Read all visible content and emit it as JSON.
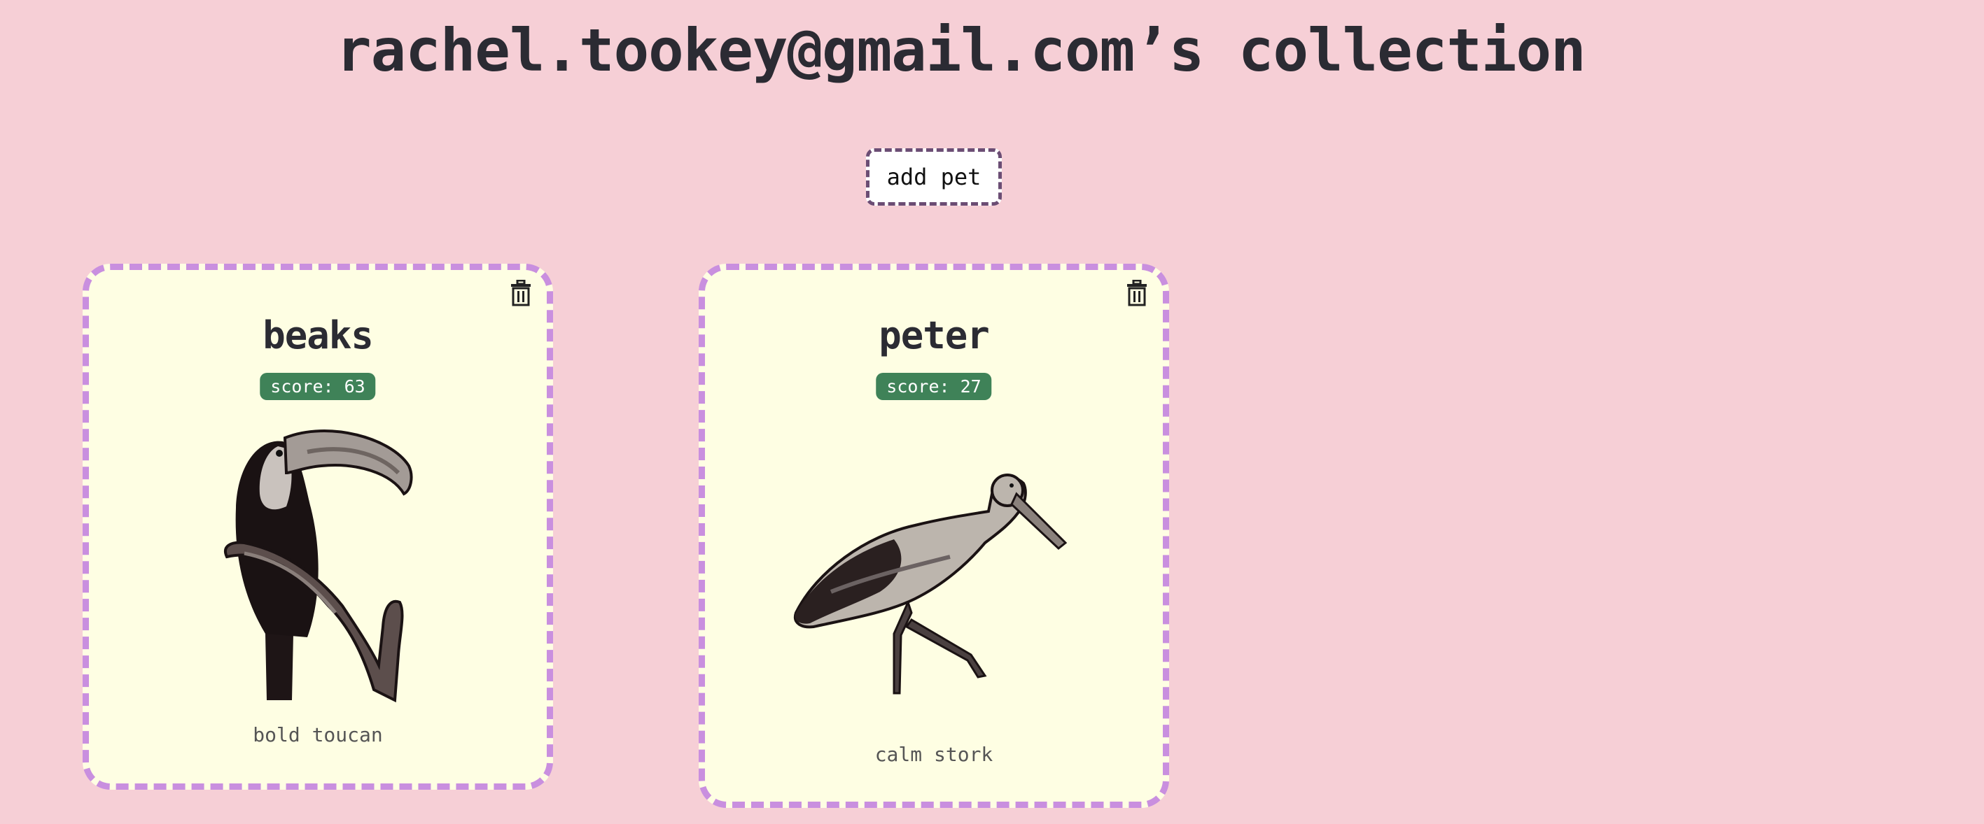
{
  "header": {
    "title": "rachel.tookey@gmail.com’s collection"
  },
  "actions": {
    "add_pet_label": "add pet"
  },
  "colors": {
    "background": "#f6cfd6",
    "card_background": "#fefee3",
    "card_border": "#c98fdf",
    "score_badge": "#3f8258",
    "button_border": "#6b4d74"
  },
  "pets": [
    {
      "name": "beaks",
      "score": "score: 63",
      "species": "bold toucan",
      "icon": "toucan-image",
      "delete_icon": "trash-icon"
    },
    {
      "name": "peter",
      "score": "score: 27",
      "species": "calm stork",
      "icon": "stork-image",
      "delete_icon": "trash-icon"
    }
  ]
}
